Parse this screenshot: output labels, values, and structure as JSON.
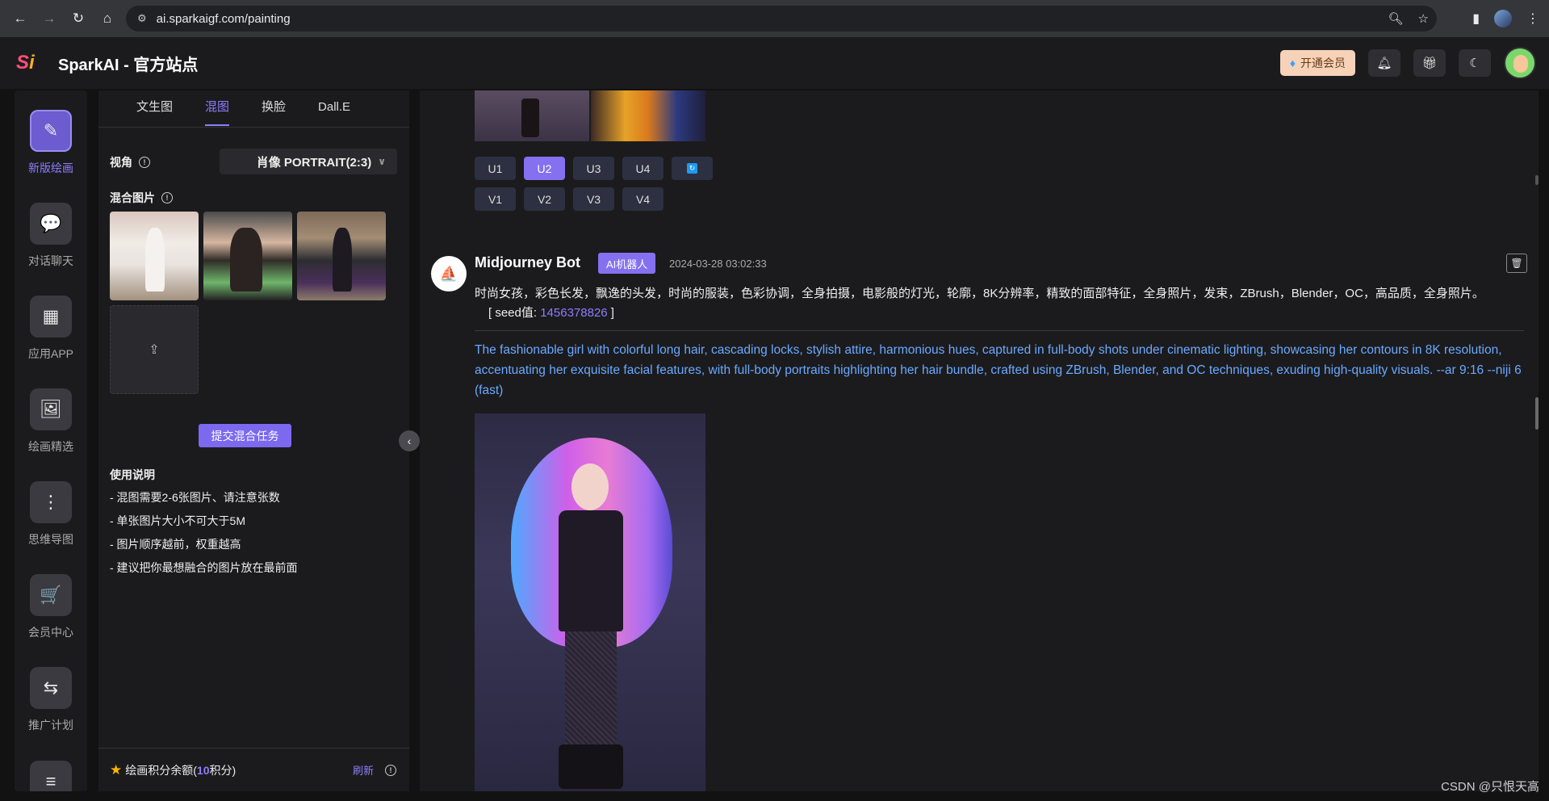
{
  "browser": {
    "url": "ai.sparkaigf.com/painting",
    "back_icon": "←",
    "forward_icon": "→",
    "reload_icon": "↻",
    "home_icon": "⌂"
  },
  "header": {
    "logo_text_s": "S",
    "logo_text_i": "i",
    "title": "SparkAI - 官方站点",
    "vip_label": "开通会员"
  },
  "rail": {
    "items": [
      {
        "label": "新版绘画",
        "icon": "✎"
      },
      {
        "label": "对话聊天",
        "icon": "💬"
      },
      {
        "label": "应用APP",
        "icon": "▦"
      },
      {
        "label": "绘画精选",
        "icon": "🖼"
      },
      {
        "label": "思维导图",
        "icon": "⋮"
      },
      {
        "label": "会员中心",
        "icon": "🛒"
      },
      {
        "label": "推广计划",
        "icon": "⇆"
      }
    ]
  },
  "panel": {
    "tabs": [
      "文生图",
      "混图",
      "换脸",
      "Dall.E"
    ],
    "view_label": "视角",
    "view_value": "肖像 PORTRAIT(2:3)",
    "blend_label": "混合图片",
    "submit_label": "提交混合任务",
    "usage_title": "使用说明",
    "usage_items": [
      "- 混图需要2-6张图片、请注意张数",
      "- 单张图片大小不可大于5M",
      "- 图片顺序越前，权重越高",
      "- 建议把你最想融合的图片放在最前面"
    ],
    "credits_prefix": "绘画积分余额(",
    "credits_value": "10",
    "credits_suffix": "积分)",
    "refresh_label": "刷新"
  },
  "main": {
    "u_buttons": [
      "U1",
      "U2",
      "U3",
      "U4"
    ],
    "v_buttons": [
      "V1",
      "V2",
      "V3",
      "V4"
    ],
    "bot_name": "Midjourney Bot",
    "bot_tag": "AI机器人",
    "time": "2024-03-28 03:02:33",
    "prompt_cn": "时尚女孩，彩色长发，飘逸的头发，时尚的服装，色彩协调，全身拍摄，电影般的灯光，轮廓，8K分辨率，精致的面部特征，全身照片，发束，ZBrush，Blender，OC，高品质，全身照片。",
    "seed_prefix": "[ seed值: ",
    "seed_value": "1456378826",
    "seed_suffix": " ]",
    "prompt_en": "The fashionable girl with colorful long hair, cascading locks, stylish attire, harmonious hues, captured in full-body shots under cinematic lighting, showcasing her contours in 8K resolution, accentuating her exquisite facial features, with full-body portraits highlighting her hair bundle, crafted using ZBrush, Blender, and OC techniques, exuding high-quality visuals. --ar 9:16 --niji 6  (fast)"
  },
  "watermark": "CSDN @只恨天高"
}
